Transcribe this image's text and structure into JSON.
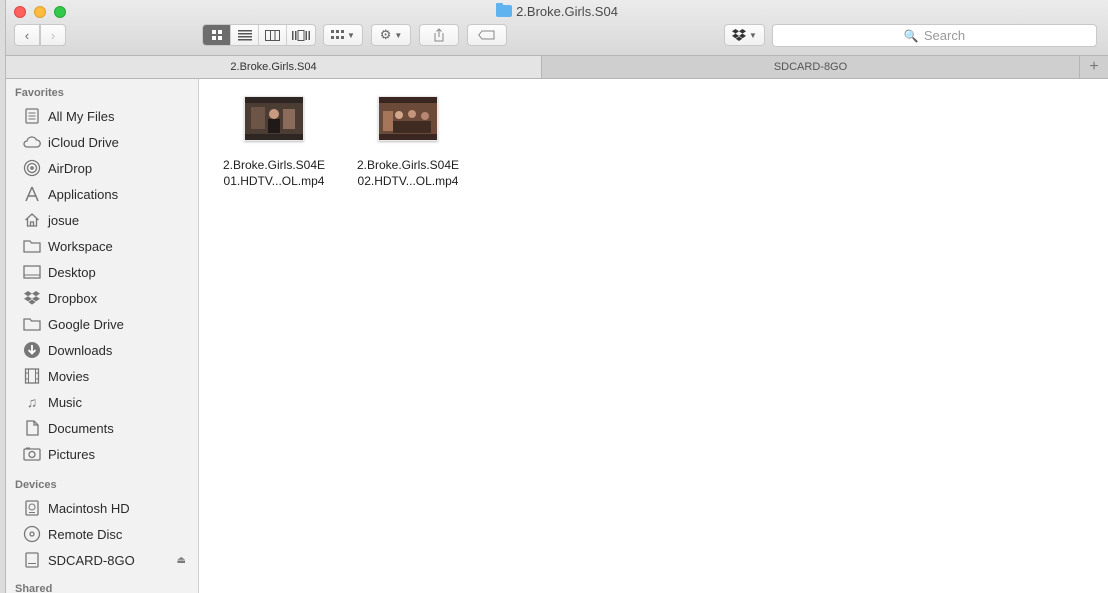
{
  "window": {
    "title": "2.Broke.Girls.S04"
  },
  "toolbar": {
    "back_icon": "chevron-left-icon",
    "forward_icon": "chevron-right-icon",
    "view_modes": [
      "icon-view",
      "list-view",
      "column-view",
      "coverflow-view"
    ],
    "active_view": "icon-view",
    "search_placeholder": "Search"
  },
  "tabs": [
    {
      "label": "2.Broke.Girls.S04",
      "active": true
    },
    {
      "label": "SDCARD-8GO",
      "active": false
    }
  ],
  "sidebar": {
    "favorites_label": "Favorites",
    "devices_label": "Devices",
    "shared_label": "Shared",
    "favorites": [
      {
        "label": "All My Files",
        "icon": "all-files-icon"
      },
      {
        "label": "iCloud Drive",
        "icon": "cloud-icon"
      },
      {
        "label": "AirDrop",
        "icon": "airdrop-icon"
      },
      {
        "label": "Applications",
        "icon": "applications-icon"
      },
      {
        "label": "josue",
        "icon": "home-icon"
      },
      {
        "label": "Workspace",
        "icon": "folder-icon"
      },
      {
        "label": "Desktop",
        "icon": "desktop-icon"
      },
      {
        "label": "Dropbox",
        "icon": "dropbox-icon"
      },
      {
        "label": "Google Drive",
        "icon": "folder-icon"
      },
      {
        "label": "Downloads",
        "icon": "downloads-icon"
      },
      {
        "label": "Movies",
        "icon": "movies-icon"
      },
      {
        "label": "Music",
        "icon": "music-icon"
      },
      {
        "label": "Documents",
        "icon": "documents-icon"
      },
      {
        "label": "Pictures",
        "icon": "pictures-icon"
      }
    ],
    "devices": [
      {
        "label": "Macintosh HD",
        "icon": "hard-drive-icon"
      },
      {
        "label": "Remote Disc",
        "icon": "disc-icon"
      },
      {
        "label": "SDCARD-8GO",
        "icon": "sd-card-icon"
      }
    ]
  },
  "files": [
    {
      "line1": "2.Broke.Girls.S04E",
      "line2": "01.HDTV...OL.mp4",
      "thumb_colors": [
        "#3a2f2a",
        "#5a4a3f",
        "#8b6b5a"
      ]
    },
    {
      "line1": "2.Broke.Girls.S04E",
      "line2": "02.HDTV...OL.mp4",
      "thumb_colors": [
        "#4a2e24",
        "#7a5440",
        "#a5765a"
      ]
    }
  ]
}
